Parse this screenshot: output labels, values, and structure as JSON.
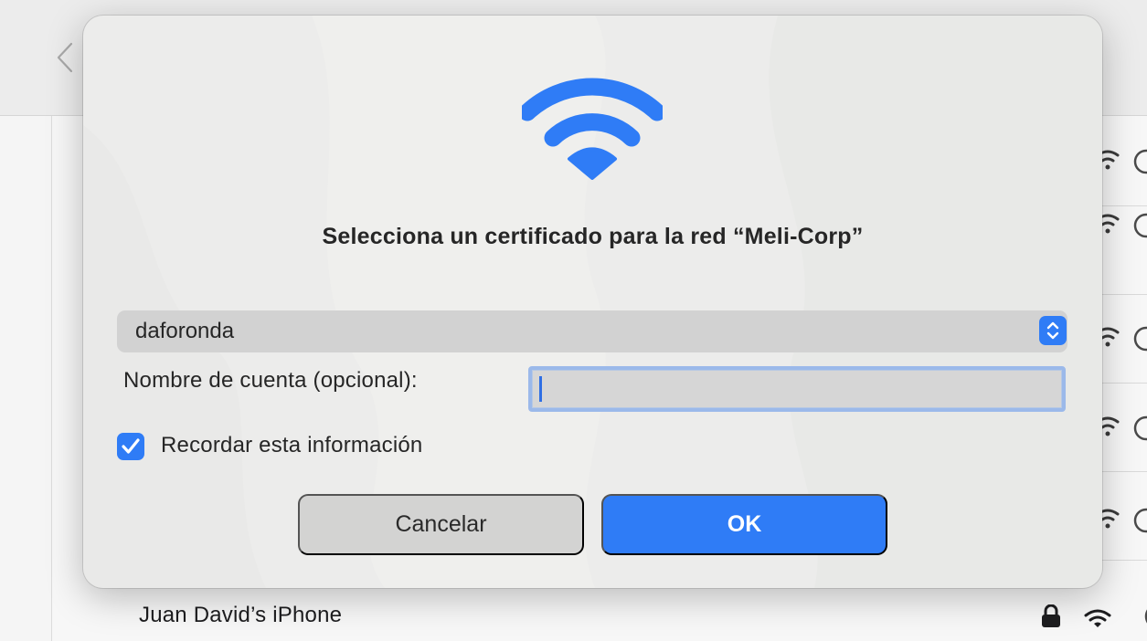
{
  "background": {
    "icons": {
      "back": "chevron-left-icon",
      "wifi": "wifi-icon",
      "info": "info-icon",
      "lock": "lock-icon"
    },
    "last_network": {
      "name": "Juan David’s iPhone"
    }
  },
  "dialog": {
    "hero_icon": "wifi-icon",
    "title": "Selecciona un certificado para la red “Meli-Corp”",
    "certificate_select": {
      "selected": "daforonda"
    },
    "account_field": {
      "label": "Nombre de cuenta (opcional):",
      "value": ""
    },
    "remember": {
      "label": "Recordar esta información",
      "checked": true
    },
    "buttons": {
      "cancel": "Cancelar",
      "ok": "OK"
    }
  },
  "colors": {
    "accent": "#2f7cf6",
    "dialog_background": "#ececeb",
    "focus_ring": "#9bb9ea"
  }
}
